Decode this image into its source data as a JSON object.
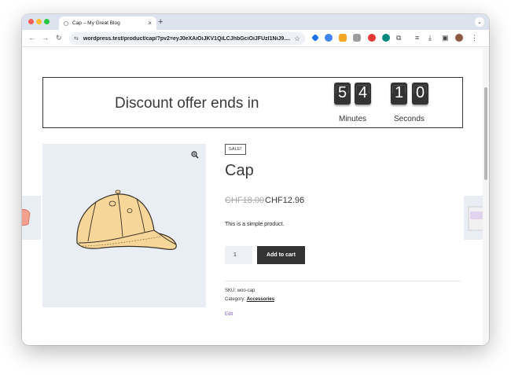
{
  "browser": {
    "tab_title": "Cap – My Great Blog",
    "tab_close": "×",
    "new_tab": "+",
    "tab_menu": "⌄",
    "url": "wordpress.test/product/cap/?pv2=eyJ0eXAiOiJKV1QiLCJhbGciOiJFUzI1NiJ9....",
    "back": "←",
    "forward": "→",
    "reload": "↻",
    "site_icon": "⇆",
    "star": "☆",
    "menu_dots": "⋮",
    "extensions": [
      {
        "icon": "tag-extension-icon",
        "color": "#1a73e8"
      },
      {
        "icon": "shield-extension-icon",
        "color": "#4285f4"
      },
      {
        "icon": "x-extension-icon",
        "color": "#f5a623"
      },
      {
        "icon": "grid-extension-icon",
        "color": "#9e9e9e"
      },
      {
        "icon": "color-extension-icon",
        "color": "#e53935"
      },
      {
        "icon": "eye-extension-icon",
        "color": "#00897b"
      }
    ]
  },
  "countdown": {
    "text": "Discount offer ends in",
    "minutes_digits": [
      "5",
      "4"
    ],
    "seconds_digits": [
      "1",
      "0"
    ],
    "minutes_label": "Minutes",
    "seconds_label": "Seconds"
  },
  "product": {
    "sale_badge": "SALE!",
    "title": "Cap",
    "old_price": "CHF18.00",
    "new_price": "CHF12.96",
    "short_description": "This is a simple product.",
    "quantity": "1",
    "add_to_cart": "Add to cart",
    "sku_label": "SKU:",
    "sku": "woo-cap",
    "category_label": "Category:",
    "category": "Accessories",
    "edit": "Edit"
  },
  "colors": {
    "accent_purple": "#7f54b3",
    "button_dark": "#333333",
    "gallery_bg": "#e9eef5"
  }
}
